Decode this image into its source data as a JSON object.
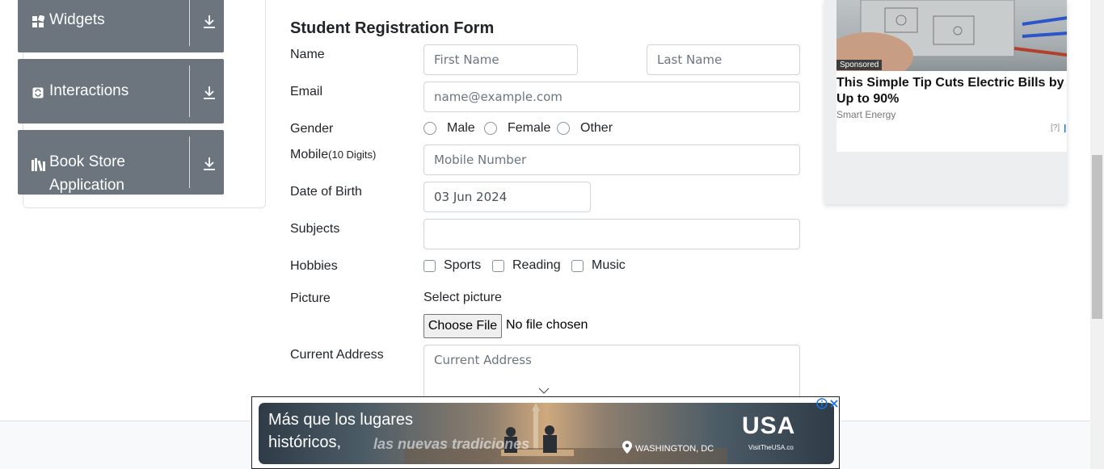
{
  "sidebar": {
    "groups": [
      {
        "label": "Widgets",
        "icon": "widgets-icon"
      },
      {
        "label": "Interactions",
        "icon": "interactions-icon"
      },
      {
        "label": "Book Store Application",
        "label_line1": "Book Store",
        "label_line2": "Application",
        "icon": "book-store-icon"
      }
    ]
  },
  "form": {
    "title": "Student Registration Form",
    "name": {
      "label": "Name",
      "first_placeholder": "First Name",
      "last_placeholder": "Last Name"
    },
    "email": {
      "label": "Email",
      "placeholder": "name@example.com"
    },
    "gender": {
      "label": "Gender",
      "options": [
        "Male",
        "Female",
        "Other"
      ]
    },
    "mobile": {
      "label": "Mobile",
      "hint": "(10 Digits)",
      "placeholder": "Mobile Number"
    },
    "dob": {
      "label": "Date of Birth",
      "value": "03 Jun 2024"
    },
    "subjects": {
      "label": "Subjects",
      "value": ""
    },
    "hobbies": {
      "label": "Hobbies",
      "options": [
        "Sports",
        "Reading",
        "Music"
      ]
    },
    "picture": {
      "label": "Picture",
      "select_text": "Select picture",
      "button": "Choose File",
      "status": "No file chosen"
    },
    "address": {
      "label": "Current Address",
      "placeholder": "Current Address"
    }
  },
  "ad_right": {
    "badge": "Sponsored",
    "headline": "This Simple Tip Cuts Electric Bills by Up to 90%",
    "brand": "Smart Energy",
    "info_label": "[?]"
  },
  "ad_bottom": {
    "line1": "Más que los lugares",
    "line2": "históricos,",
    "tagline": "las nuevas tradiciones",
    "location": "WASHINGTON, DC",
    "logo": "USA",
    "logo_sub": "VisitTheUSA.co"
  },
  "colors": {
    "sidebar_bg": "#6c757d",
    "border": "#ced4da",
    "placeholder": "#6c757d",
    "ad_link_blue": "#1a73e8"
  }
}
